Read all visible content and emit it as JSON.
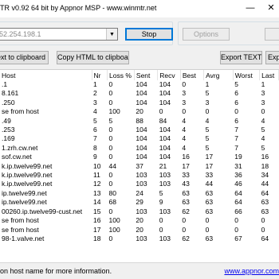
{
  "window": {
    "title": "TR v0.92 64 bit by Appnor MSP - www.winmtr.net",
    "minimize": "—",
    "close": "✕"
  },
  "host": {
    "value": "52.254.198.1"
  },
  "buttons": {
    "stop": "Stop",
    "options": "Options",
    "copy_text": "ext to clipboard",
    "copy_html": "Copy HTML to clipboard",
    "export_text": "Export TEXT",
    "export_other": "Exp"
  },
  "table": {
    "columns": [
      "Host",
      "Nr",
      "Loss %",
      "Sent",
      "Recv",
      "Best",
      "Avrg",
      "Worst",
      "Last"
    ],
    "rows": [
      [
        ".1",
        "1",
        "0",
        "104",
        "104",
        "0",
        "1",
        "5",
        "1"
      ],
      [
        "8.161",
        "2",
        "0",
        "104",
        "104",
        "3",
        "5",
        "6",
        "3"
      ],
      ".250|3|0|104|104|3|3|6|3",
      [
        "se from host",
        "4",
        "100",
        "20",
        "0",
        "0",
        "0",
        "0",
        "0"
      ],
      [
        ".49",
        "5",
        "5",
        "88",
        "84",
        "4",
        "4",
        "6",
        "4"
      ],
      [
        ".253",
        "6",
        "0",
        "104",
        "104",
        "4",
        "5",
        "7",
        "5"
      ],
      [
        ".169",
        "7",
        "0",
        "104",
        "104",
        "4",
        "5",
        "7",
        "4"
      ],
      [
        "1.zrh.cw.net",
        "8",
        "0",
        "104",
        "104",
        "4",
        "5",
        "7",
        "5"
      ],
      [
        "sof.cw.net",
        "9",
        "0",
        "104",
        "104",
        "16",
        "17",
        "19",
        "16"
      ],
      [
        "k.ip.twelve99.net",
        "10",
        "44",
        "37",
        "21",
        "17",
        "17",
        "31",
        "18"
      ],
      [
        "k.ip.twelve99.net",
        "11",
        "0",
        "103",
        "103",
        "33",
        "33",
        "36",
        "34"
      ],
      [
        "k.ip.twelve99.net",
        "12",
        "0",
        "103",
        "103",
        "43",
        "44",
        "46",
        "44"
      ],
      [
        "ip.twelve99.net",
        "13",
        "80",
        "24",
        "5",
        "63",
        "63",
        "64",
        "64"
      ],
      [
        "ip.twelve99.net",
        "14",
        "68",
        "29",
        "9",
        "63",
        "63",
        "64",
        "63"
      ],
      [
        "00260.ip.twelve99-cust.net",
        "15",
        "0",
        "103",
        "103",
        "62",
        "63",
        "66",
        "63"
      ],
      [
        "se from host",
        "16",
        "100",
        "20",
        "0",
        "0",
        "0",
        "0",
        "0"
      ],
      [
        "se from host",
        "17",
        "100",
        "20",
        "0",
        "0",
        "0",
        "0",
        "0"
      ],
      [
        "98-1.valve.net",
        "18",
        "0",
        "103",
        "103",
        "62",
        "63",
        "67",
        "64"
      ]
    ]
  },
  "status": {
    "message": "on host name for more information.",
    "link": "www.appnor.com"
  }
}
